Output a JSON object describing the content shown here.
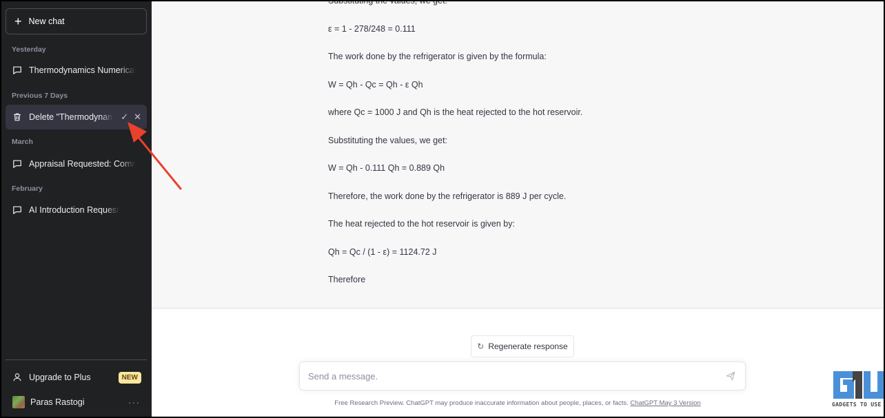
{
  "sidebar": {
    "new_chat_label": "New chat",
    "sections": [
      {
        "label": "Yesterday"
      },
      {
        "label": "Previous 7 Days"
      },
      {
        "label": "March"
      },
      {
        "label": "February"
      }
    ],
    "items": [
      {
        "label": "Thermodynamics Numerical Q",
        "icon": "chat-bubble-icon"
      },
      {
        "label": "Delete \"Thermodynamics Numerical Q",
        "icon": "trash-icon",
        "state": "confirm-delete"
      },
      {
        "label": "Appraisal Requested: Commit",
        "icon": "chat-bubble-icon"
      },
      {
        "label": "AI Introduction Request",
        "icon": "chat-bubble-icon"
      }
    ],
    "confirm_icon": "✓",
    "cancel_icon": "✕",
    "upgrade_label": "Upgrade to Plus",
    "upgrade_badge": "NEW",
    "user_name": "Paras Rastogi",
    "more_label": "···"
  },
  "message": {
    "lines": [
      "Substituting the values, we get:",
      "ε = 1 - 278/248 = 0.111",
      "The work done by the refrigerator is given by the formula:",
      "W = Qh - Qc = Qh - ε Qh",
      "where Qc = 1000 J and Qh is the heat rejected to the hot reservoir.",
      "Substituting the values, we get:",
      "W = Qh - 0.111 Qh = 0.889 Qh",
      "Therefore, the work done by the refrigerator is 889 J per cycle.",
      "The heat rejected to the hot reservoir is given by:",
      "Qh = Qc / (1 - ε) = 1124.72 J",
      "Therefore"
    ]
  },
  "composer": {
    "regenerate_label": "Regenerate response",
    "placeholder": "Send a message.",
    "disclaimer": "Free Research Preview. ChatGPT may produce inaccurate information about people, places, or facts.",
    "version_link": "ChatGPT May 3 Version"
  },
  "watermark": {
    "text": "GADGETS TO USE",
    "colors": {
      "blue": "#4a90d9",
      "dark": "#444444"
    }
  },
  "colors": {
    "sidebar_bg": "#202123",
    "active_item": "#343541",
    "arrow": "#e8412c",
    "badge": "#fae69e"
  }
}
